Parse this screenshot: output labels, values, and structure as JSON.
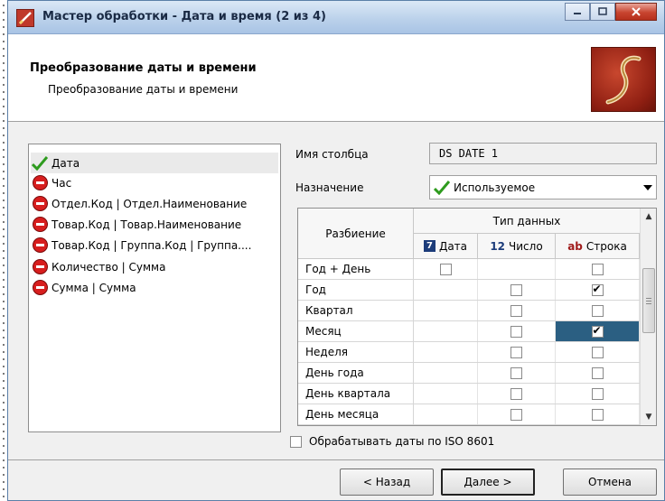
{
  "window": {
    "title": "Мастер обработки - Дата и время (2 из 4)"
  },
  "header": {
    "title": "Преобразование даты и времени",
    "subtitle": "Преобразование даты и времени"
  },
  "columns_list": [
    {
      "label": "Дата",
      "icon": "checkmark-icon",
      "selected": true
    },
    {
      "label": "Час",
      "icon": "stop-icon"
    },
    {
      "label": "Отдел.Код | Отдел.Наименование",
      "icon": "stop-icon"
    },
    {
      "label": "Товар.Код | Товар.Наименование",
      "icon": "stop-icon"
    },
    {
      "label": "Товар.Код | Группа.Код | Группа....",
      "icon": "stop-icon"
    },
    {
      "label": "Количество | Сумма",
      "icon": "stop-icon"
    },
    {
      "label": "Сумма | Сумма",
      "icon": "stop-icon"
    }
  ],
  "form": {
    "column_name_label": "Имя столбца",
    "column_name_value": "DS DATE 1",
    "purpose_label": "Назначение",
    "purpose_value": "Используемое"
  },
  "grid": {
    "split_header": "Разбиение",
    "datatype_header": "Тип данных",
    "type_date": {
      "badge": "7",
      "label": "Дата"
    },
    "type_number": {
      "badge": "12",
      "label": "Число"
    },
    "type_string": {
      "badge": "ab",
      "label": "Строка"
    },
    "rows": [
      {
        "label": "Год + День",
        "date": false,
        "number": null,
        "string": false
      },
      {
        "label": "Год",
        "date": null,
        "number": false,
        "string": true
      },
      {
        "label": "Квартал",
        "date": null,
        "number": false,
        "string": false
      },
      {
        "label": "Месяц",
        "date": null,
        "number": false,
        "string": true,
        "highlight": "string"
      },
      {
        "label": "Неделя",
        "date": null,
        "number": false,
        "string": false
      },
      {
        "label": "День года",
        "date": null,
        "number": false,
        "string": false
      },
      {
        "label": "День квартала",
        "date": null,
        "number": false,
        "string": false
      },
      {
        "label": "День месяца",
        "date": null,
        "number": false,
        "string": false
      }
    ]
  },
  "iso_checkbox": {
    "label": "Обрабатывать даты по ISO 8601",
    "checked": false
  },
  "buttons": {
    "back": "< Назад",
    "next": "Далее >",
    "cancel": "Отмена"
  },
  "colors": {
    "highlight": "#2b5f82",
    "check_green": "#2e9b1e",
    "stop_red": "#d71e1e"
  }
}
